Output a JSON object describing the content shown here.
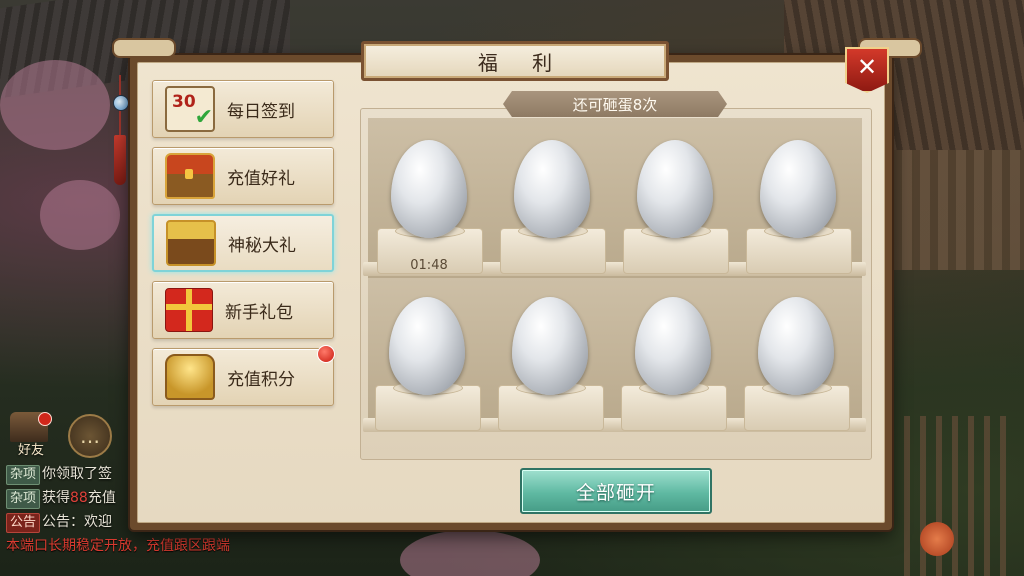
{
  "panel": {
    "title": "福  利",
    "close_label": "✕"
  },
  "sidebar": {
    "items": [
      {
        "label": "每日签到",
        "icon": "calendar-icon",
        "icon_text": "30"
      },
      {
        "label": "充值好礼",
        "icon": "treasure-chest-icon"
      },
      {
        "label": "神秘大礼",
        "icon": "golden-chest-icon",
        "active": true
      },
      {
        "label": "新手礼包",
        "icon": "gift-box-icon"
      },
      {
        "label": "充值积分",
        "icon": "gold-pile-icon",
        "badge": true
      }
    ]
  },
  "eggs": {
    "remaining_text": "还可砸蛋8次",
    "timer": "01:48",
    "count": 8
  },
  "actions": {
    "smash_all_label": "全部砸开"
  },
  "hud": {
    "friend_label": "好友",
    "chat_icon": "chat-bubble-icon"
  },
  "chat": {
    "lines": [
      {
        "tag": "杂项",
        "text": "你领取了签"
      },
      {
        "tag": "杂项",
        "text_a": "获得",
        "text_red": "88",
        "text_b": "充值"
      },
      {
        "tag": "公告",
        "text": "公告：欢迎"
      }
    ],
    "warning": "本端口长期稳定开放，充值跟区跟端"
  },
  "colors": {
    "panel_border": "#6b4a2c",
    "active_tab_glow": "#7fd3d8",
    "button_green": "#5fb9a2",
    "close_red": "#d3392a"
  }
}
